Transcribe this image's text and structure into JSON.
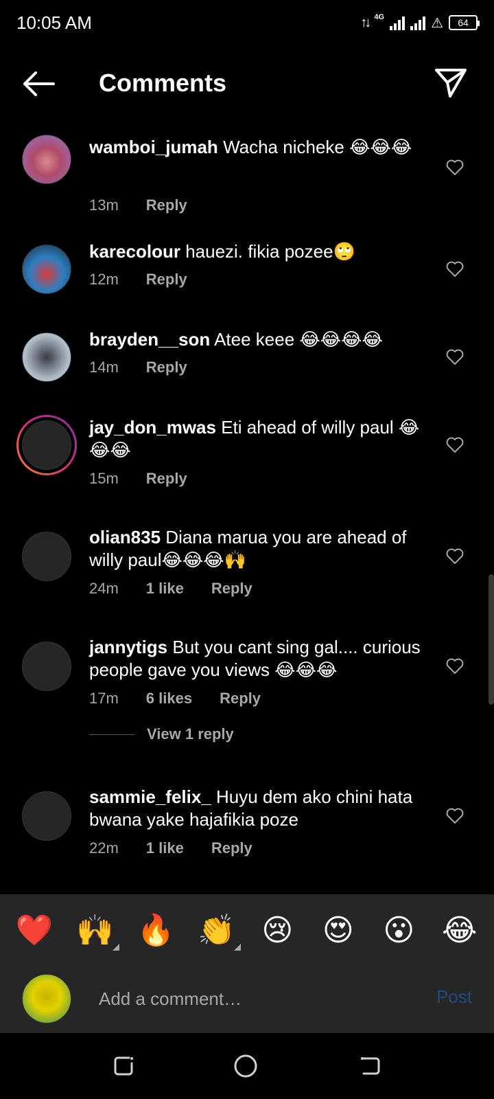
{
  "status": {
    "time": "10:05 AM",
    "network": "4G",
    "battery": "64"
  },
  "header": {
    "title": "Comments"
  },
  "comments": [
    {
      "username": "wamboi_jumah",
      "text": "Wacha nicheke 😂😂😂",
      "time": "13m",
      "likes": "",
      "reply": "Reply"
    },
    {
      "username": "karecolour",
      "text": "hauezi. fikia pozee🙄",
      "time": "12m",
      "likes": "",
      "reply": "Reply"
    },
    {
      "username": "brayden__son",
      "text": "Atee keee 😂😂😂😂",
      "time": "14m",
      "likes": "",
      "reply": "Reply"
    },
    {
      "username": "jay_don_mwas",
      "text": "Eti ahead of willy paul 😂😂😂",
      "time": "15m",
      "likes": "",
      "reply": "Reply"
    },
    {
      "username": "olian835",
      "text": "Diana marua you are ahead of willy paul😂😂😂🙌",
      "time": "24m",
      "likes": "1 like",
      "reply": "Reply"
    },
    {
      "username": "jannytigs",
      "text": "But you cant sing gal.... curious people gave you views 😂😂😂",
      "time": "17m",
      "likes": "6 likes",
      "reply": "Reply"
    },
    {
      "username": "sammie_felix_",
      "text": "Huyu dem ako chini hata bwana yake hajafikia poze",
      "time": "22m",
      "likes": "1 like",
      "reply": "Reply"
    }
  ],
  "view_replies": "View 1 reply",
  "emoji_bar": [
    "❤️",
    "🙌",
    "🔥",
    "👏",
    "😢",
    "😍",
    "😮",
    "😂"
  ],
  "composer": {
    "placeholder": "Add a comment…",
    "post_label": "Post"
  },
  "colors": {
    "background": "#000000",
    "secondary_text": "#a8a8a8",
    "post_disabled": "#1f4d7a"
  }
}
